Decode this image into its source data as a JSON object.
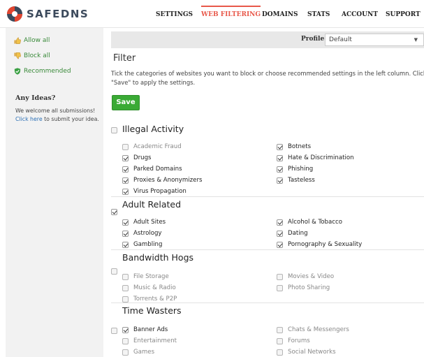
{
  "brand": {
    "logo_text": "SAFEDNS"
  },
  "nav": [
    {
      "label": "SETTINGS",
      "active": false
    },
    {
      "label": "WEB FILTERING",
      "active": true
    },
    {
      "label": "DOMAINS",
      "active": false
    },
    {
      "label": "STATS",
      "active": false
    },
    {
      "label": "ACCOUNT",
      "active": false
    },
    {
      "label": "SUPPORT",
      "active": false
    }
  ],
  "sidebar": {
    "actions": [
      {
        "label": "Allow all",
        "icon": "thumbs-up-icon"
      },
      {
        "label": "Block all",
        "icon": "thumbs-down-icon"
      },
      {
        "label": "Recommended",
        "icon": "shield-check-icon"
      }
    ],
    "ideas": {
      "title": "Any Ideas?",
      "text": "We welcome all submissions!",
      "link": "Click here",
      "link_suffix": " to submit your idea."
    }
  },
  "profile": {
    "label": "Profile",
    "selected": "Default"
  },
  "filter": {
    "title": "Filter",
    "description": "Tick the categories of websites you want to block or choose recommended settings in the left column. Click \"Save\" to apply the settings.",
    "save_label": "Save"
  },
  "sections": [
    {
      "title": "Illegal Activity",
      "checked": false,
      "left": [
        {
          "label": "Academic Fraud",
          "checked": false
        },
        {
          "label": "Drugs",
          "checked": true
        },
        {
          "label": "Parked Domains",
          "checked": true
        },
        {
          "label": "Proxies & Anonymizers",
          "checked": true
        },
        {
          "label": "Virus Propagation",
          "checked": true
        }
      ],
      "right": [
        {
          "label": "Botnets",
          "checked": true
        },
        {
          "label": "Hate & Discrimination",
          "checked": true
        },
        {
          "label": "Phishing",
          "checked": true
        },
        {
          "label": "Tasteless",
          "checked": true
        }
      ]
    },
    {
      "title": "Adult Related",
      "checked": true,
      "left": [
        {
          "label": "Adult Sites",
          "checked": true
        },
        {
          "label": "Astrology",
          "checked": true
        },
        {
          "label": "Gambling",
          "checked": true
        }
      ],
      "right": [
        {
          "label": "Alcohol & Tobacco",
          "checked": true
        },
        {
          "label": "Dating",
          "checked": true
        },
        {
          "label": "Pornography & Sexuality",
          "checked": true
        }
      ]
    },
    {
      "title": "Bandwidth Hogs",
      "checked": false,
      "left": [
        {
          "label": "File Storage",
          "checked": false
        },
        {
          "label": "Music & Radio",
          "checked": false
        },
        {
          "label": "Torrents & P2P",
          "checked": false
        }
      ],
      "right": [
        {
          "label": "Movies & Video",
          "checked": false
        },
        {
          "label": "Photo Sharing",
          "checked": false
        }
      ]
    },
    {
      "title": "Time Wasters",
      "checked": false,
      "left": [
        {
          "label": "Banner Ads",
          "checked": true
        },
        {
          "label": "Entertainment",
          "checked": false
        },
        {
          "label": "Games",
          "checked": false
        }
      ],
      "right": [
        {
          "label": "Chats & Messengers",
          "checked": false
        },
        {
          "label": "Forums",
          "checked": false
        },
        {
          "label": "Social Networks",
          "checked": false
        }
      ]
    }
  ]
}
